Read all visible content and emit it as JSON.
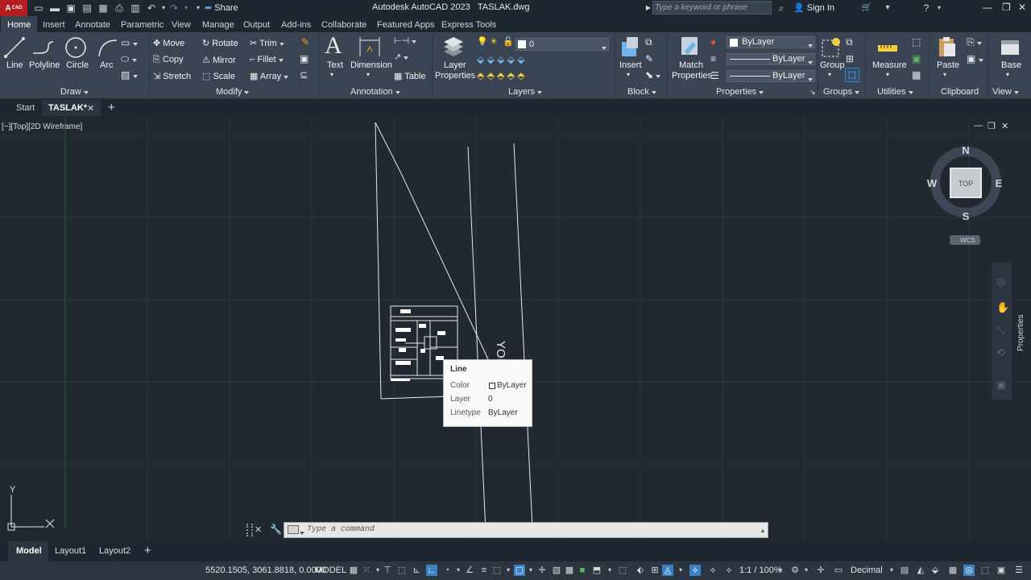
{
  "app": {
    "logo_label": "CAD",
    "title": "Autodesk AutoCAD 2023",
    "filename": "TASLAK.dwg",
    "share_label": "Share",
    "search_placeholder": "Type a keyword or phrase",
    "signin_label": "Sign In"
  },
  "ribbon_tabs": [
    "Home",
    "Insert",
    "Annotate",
    "Parametric",
    "View",
    "Manage",
    "Output",
    "Add-ins",
    "Collaborate",
    "Featured Apps",
    "Express Tools"
  ],
  "ribbon": {
    "draw": {
      "label": "Draw",
      "line": "Line",
      "polyline": "Polyline",
      "circle": "Circle",
      "arc": "Arc"
    },
    "modify": {
      "label": "Modify",
      "move": "Move",
      "rotate": "Rotate",
      "trim": "Trim",
      "copy": "Copy",
      "mirror": "Mirror",
      "fillet": "Fillet",
      "stretch": "Stretch",
      "scale": "Scale",
      "array": "Array"
    },
    "annotation": {
      "label": "Annotation",
      "text": "Text",
      "dimension": "Dimension",
      "table": "Table"
    },
    "layers": {
      "label": "Layers",
      "layer_properties_1": "Layer",
      "layer_properties_2": "Properties",
      "current_layer": "0"
    },
    "block": {
      "label": "Block",
      "insert": "Insert"
    },
    "properties": {
      "label": "Properties",
      "match_1": "Match",
      "match_2": "Properties",
      "color": "ByLayer",
      "lineweight": "ByLayer",
      "linetype": "ByLayer"
    },
    "groups": {
      "label": "Groups",
      "group": "Group"
    },
    "utilities": {
      "label": "Utilities",
      "measure": "Measure"
    },
    "clipboard": {
      "label": "Clipboard",
      "paste": "Paste"
    },
    "view": {
      "label": "View",
      "base": "Base"
    }
  },
  "doc_tabs": {
    "start": "Start",
    "active": "TASLAK*"
  },
  "viewport": {
    "info": "[−][Top][2D Wireframe]",
    "viewcube": {
      "n": "N",
      "s": "S",
      "e": "E",
      "w": "W",
      "top": "TOP",
      "wcs": "WCS"
    },
    "ucs_y": "Y",
    "road_label": "YOL",
    "properties_palette": "Properties"
  },
  "tooltip": {
    "title": "Line",
    "rows": [
      {
        "key": "Color",
        "value": "ByLayer"
      },
      {
        "key": "Layer",
        "value": "0"
      },
      {
        "key": "Linetype",
        "value": "ByLayer"
      }
    ]
  },
  "command": {
    "placeholder": "Type a command"
  },
  "layout_tabs": [
    "Model",
    "Layout1",
    "Layout2"
  ],
  "status": {
    "coords": "5520.1505, 3061.8818, 0.0000",
    "space": "MODEL",
    "scale": "1:1 / 100%",
    "units": "Decimal"
  },
  "colors": {
    "ribbon_bg": "#3b4453",
    "canvas_bg": "#212830",
    "app_red": "#b51d22",
    "accent": "#3b82c4"
  }
}
